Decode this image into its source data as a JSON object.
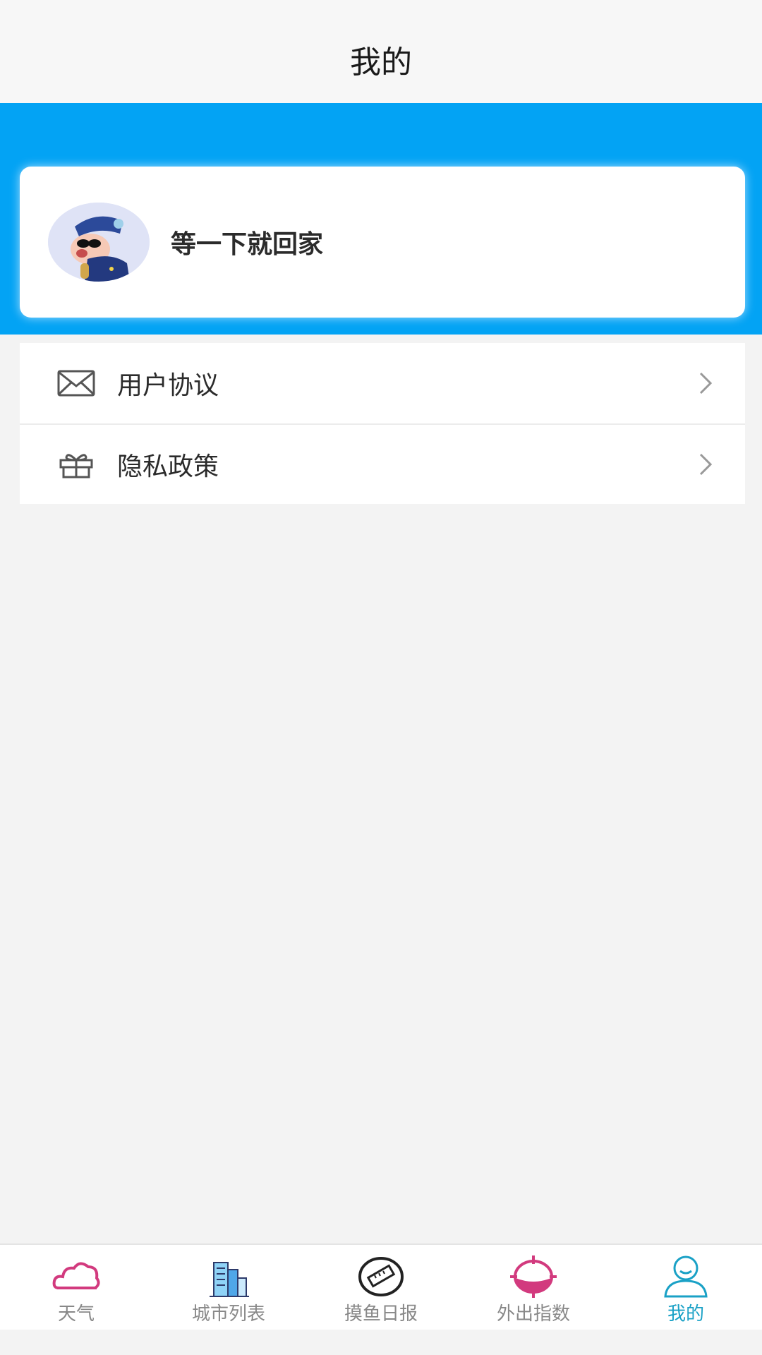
{
  "header": {
    "title": "我的"
  },
  "profile": {
    "username": "等一下就回家",
    "avatar": "cartoon-avatar"
  },
  "menu": {
    "items": [
      {
        "label": "用户协议",
        "icon": "envelope-icon"
      },
      {
        "label": "隐私政策",
        "icon": "gift-icon"
      }
    ]
  },
  "tabbar": {
    "items": [
      {
        "label": "天气",
        "icon": "cloud-icon"
      },
      {
        "label": "城市列表",
        "icon": "buildings-icon"
      },
      {
        "label": "摸鱼日报",
        "icon": "ruler-icon"
      },
      {
        "label": "外出指数",
        "icon": "target-icon"
      },
      {
        "label": "我的",
        "icon": "user-icon",
        "active": true
      }
    ]
  },
  "colors": {
    "accent_blue": "#03a3f4",
    "tab_active": "#1aa1c6",
    "tab_pink": "#d23a7e"
  }
}
